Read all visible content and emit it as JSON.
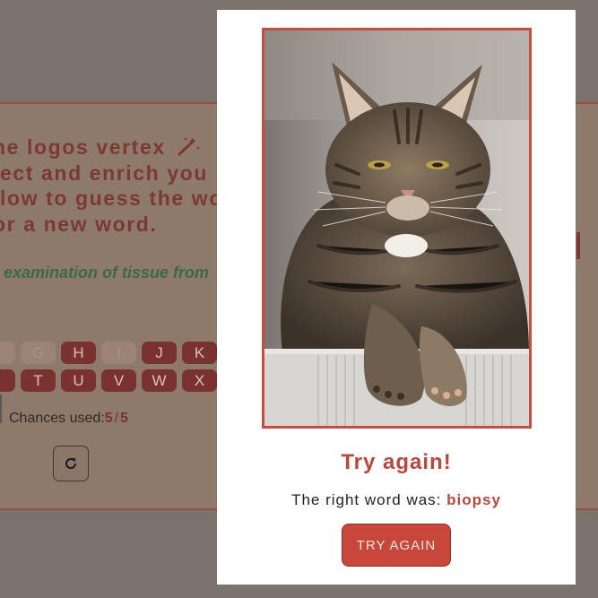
{
  "game": {
    "heading_lines": [
      "he logos vertex",
      "lect and enrich you",
      "llow to guess the wo",
      "or a new word."
    ],
    "hint": "examination of tissue from",
    "keyboard": {
      "row1": [
        {
          "letter": "",
          "used": true
        },
        {
          "letter": "G",
          "used": true
        },
        {
          "letter": "H",
          "used": false
        },
        {
          "letter": "I",
          "used": true
        },
        {
          "letter": "J",
          "used": false
        },
        {
          "letter": "K",
          "used": false
        },
        {
          "letter": "",
          "used": false
        }
      ],
      "row2": [
        {
          "letter": "",
          "used": false
        },
        {
          "letter": "T",
          "used": false
        },
        {
          "letter": "U",
          "used": false
        },
        {
          "letter": "V",
          "used": false
        },
        {
          "letter": "W",
          "used": false
        },
        {
          "letter": "X",
          "used": false
        },
        {
          "letter": "",
          "used": false
        }
      ]
    },
    "chances_label": "Chances used:",
    "chances_used": "5",
    "chances_sep": "/",
    "chances_total": "5"
  },
  "modal": {
    "title": "Try again!",
    "text_prefix": "The right word was:",
    "answer": "biopsy",
    "button_label": "TRY AGAIN"
  },
  "icons": {
    "wand": "magic-wand-icon",
    "reset": "refresh-icon"
  },
  "colors": {
    "accent": "#c8473a",
    "overlay": "#7b736b",
    "hint_green": "#3e6948"
  }
}
